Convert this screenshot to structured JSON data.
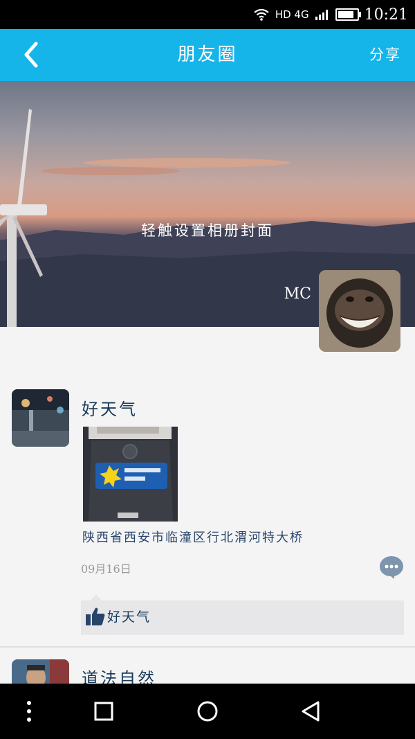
{
  "status_bar": {
    "network": "HD 4G",
    "time": "10:21",
    "icons": [
      "wifi-icon",
      "signal-icon",
      "battery-icon"
    ],
    "battery_level": 0.85
  },
  "header": {
    "back_icon": "chevron-left-icon",
    "title": "朋友圈",
    "share_label": "分享"
  },
  "cover": {
    "hint": "轻触设置相册封面"
  },
  "profile": {
    "name": "MC"
  },
  "posts": [
    {
      "author": "好天气",
      "location": "陕西省西安市临潼区行北渭河特大桥",
      "date": "09月16日",
      "likes": [
        "好天气"
      ]
    },
    {
      "author": "道法自然"
    }
  ],
  "colors": {
    "header_bg": "#15b5ea",
    "link": "#27446b",
    "background": "#f4f4f4"
  },
  "bottom_nav": {
    "icons": [
      "menu-dots-icon",
      "recent-apps-icon",
      "home-icon",
      "back-icon"
    ]
  }
}
